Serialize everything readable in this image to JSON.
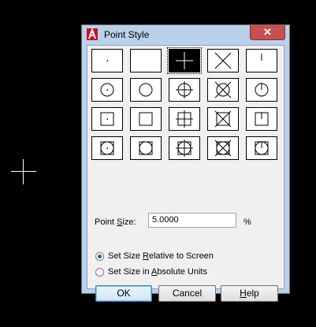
{
  "dialog": {
    "title": "Point Style",
    "close_label": "✕"
  },
  "point_styles": [
    [
      "dot",
      "none",
      "plus",
      "x",
      "tick"
    ],
    [
      "circle-dot",
      "circle",
      "circle-plus",
      "circle-x",
      "circle-tick"
    ],
    [
      "square-dot",
      "square",
      "square-plus",
      "square-x",
      "square-tick"
    ],
    [
      "circle-square-dot",
      "circle-square",
      "circle-square-plus",
      "circle-square-x",
      "circle-square-tick"
    ]
  ],
  "selected_style": "plus",
  "point_size": {
    "label_pre": "Point ",
    "label_ul": "S",
    "label_post": "ize:",
    "value": "5.0000",
    "unit": "%"
  },
  "size_mode": {
    "relative": {
      "pre": "Set Size ",
      "ul": "R",
      "post": "elative to Screen",
      "selected": true
    },
    "absolute": {
      "pre": "Set Size in ",
      "ul": "A",
      "post": "bsolute Units",
      "selected": false
    }
  },
  "buttons": {
    "ok": "OK",
    "cancel": "Cancel",
    "help_ul": "H",
    "help_post": "elp"
  },
  "colors": {
    "accent": "#1e5fb0",
    "close": "#c75050",
    "app_icon": "#c8102e"
  }
}
